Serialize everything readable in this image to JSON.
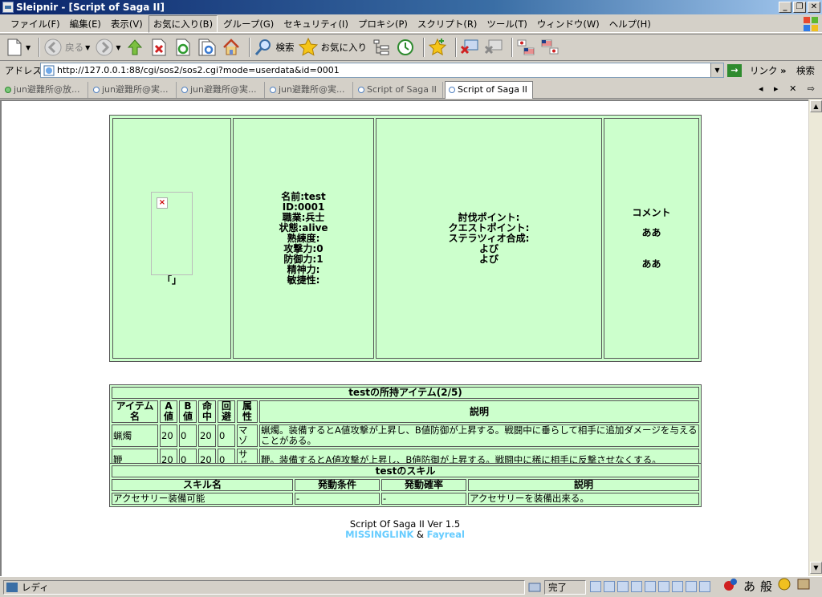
{
  "window": {
    "title": "Sleipnir - [Script of Saga II]",
    "btn_min": "_",
    "btn_max": "❐",
    "btn_close": "✕"
  },
  "menu": [
    "ファイル(F)",
    "編集(E)",
    "表示(V)",
    "お気に入り(B)",
    "グループ(G)",
    "セキュリティ(I)",
    "プロキシ(P)",
    "スクリプト(R)",
    "ツール(T)",
    "ウィンドウ(W)",
    "ヘルプ(H)"
  ],
  "toolbar": {
    "back_label": "戻る",
    "search_label": "検索",
    "favorites_label": "お気に入り"
  },
  "address": {
    "label": "アドレス",
    "url": "http://127.0.0.1:88/cgi/sos2/sos2.cgi?mode=userdata&id=0001",
    "link_label": "リンク",
    "link_more": "»",
    "search_label": "検索",
    "go_label": "→"
  },
  "tabs": [
    {
      "title": "jun避難所@放...",
      "status": "green"
    },
    {
      "title": "jun避難所@実...",
      "status": "blue"
    },
    {
      "title": "jun避難所@実...",
      "status": "blue"
    },
    {
      "title": "jun避難所@実...",
      "status": "blue"
    },
    {
      "title": "Script of Saga II",
      "status": "blue"
    },
    {
      "title": "Script of Saga II",
      "status": "blue",
      "active": true
    }
  ],
  "tab_controls": "◂ ▸ ✕ ⇨",
  "character": {
    "image_caption": "「」",
    "broken_image": "×",
    "name": "名前:test",
    "id": "ID:0001",
    "job": "職業:兵士",
    "state": "状態:alive",
    "skill_level": "熟練度:",
    "attack": "攻撃力:0",
    "defense": "防御力:1",
    "spirit": "精神力:",
    "agility": "敏捷性:"
  },
  "points": {
    "quest_kill": "討伐ポイント:",
    "quest": "クエストポイント:",
    "stellatio": "ステラツィオ合成:",
    "line4": "よび",
    "line5": "よび"
  },
  "comment": {
    "label": "コメント",
    "line1": "ああ",
    "line2": "ああ"
  },
  "items": {
    "title": "testの所持アイテム(2/5)",
    "headers": {
      "name": "アイテム名",
      "a": "A値",
      "b": "B値",
      "hit": "命中",
      "evade": "回避",
      "attr": "属性",
      "desc": "説明"
    },
    "rows": [
      {
        "name": "蝋燭",
        "a": "20",
        "b": "0",
        "hit": "20",
        "evade": "0",
        "attr": "マゾ",
        "desc": "蝋燭。装備するとA値攻撃が上昇し、B値防御が上昇する。戦闘中に垂らして相手に追加ダメージを与えることがある。"
      },
      {
        "name": "鞭",
        "a": "20",
        "b": "0",
        "hit": "20",
        "evade": "0",
        "attr": "サド",
        "desc": "鞭。装備するとA値攻撃が上昇し、B値防御が上昇する。戦闘中に稀に相手に反撃させなくする。"
      }
    ]
  },
  "skills": {
    "title": "testのスキル",
    "headers": {
      "name": "スキル名",
      "cond": "発動条件",
      "rate": "発動確率",
      "desc": "説明"
    },
    "rows": [
      {
        "name": "アクセサリー装備可能",
        "cond": "-",
        "rate": "-",
        "desc": "アクセサリーを装備出来る。"
      }
    ]
  },
  "footer": {
    "line1": "Script Of Saga II Ver 1.5",
    "link1": "MISSINGLINK",
    "amp": "&",
    "link2": "Fayreal"
  },
  "status": {
    "text": "レディ",
    "done": "完了",
    "ime": [
      "あ",
      "般"
    ]
  },
  "scroll": {
    "up": "▲",
    "down": "▼"
  }
}
